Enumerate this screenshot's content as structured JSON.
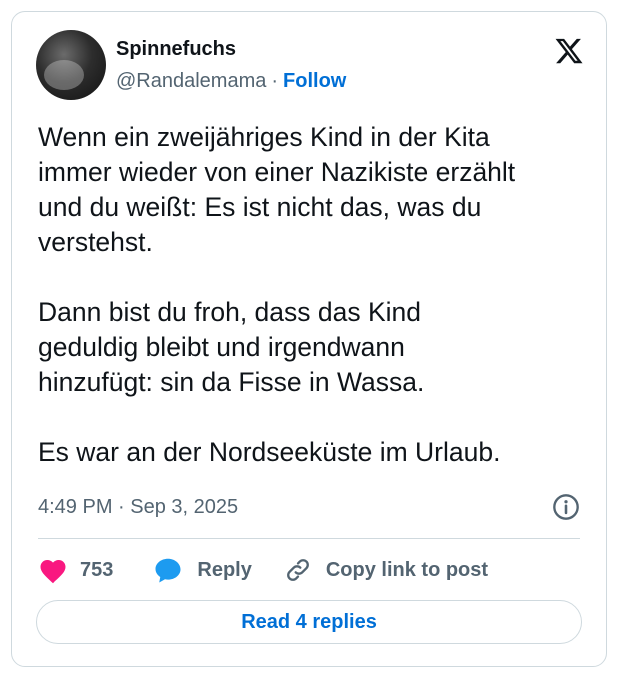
{
  "author": {
    "name": "Spinnefuchs",
    "handle": "@Randalemama",
    "separator": "·",
    "follow_label": "Follow"
  },
  "tweet": {
    "text": "Wenn ein zweijähriges Kind in der Kita\nimmer wieder von einer Nazikiste erzählt\nund du weißt: Es ist nicht das, was du\nverstehst.\n\nDann bist du froh, dass das Kind\ngeduldig bleibt und irgendwann\nhinzufügt: sin da Fisse in Wassa.\n\nEs war an der Nordseeküste im Urlaub.",
    "timestamp": "4:49 PM · Sep 3, 2025"
  },
  "actions": {
    "like_count": "753",
    "reply_label": "Reply",
    "copy_label": "Copy link to post",
    "read_replies_label": "Read 4 replies"
  },
  "icons": {
    "platform": "x-logo-icon",
    "like": "heart-icon",
    "reply": "speech-bubble-icon",
    "copy": "link-icon",
    "info": "info-icon"
  },
  "colors": {
    "like": "#f91880",
    "reply": "#1d9bf0",
    "link_text": "#006fd6",
    "secondary_text": "#536471",
    "border": "#cfd9de"
  }
}
